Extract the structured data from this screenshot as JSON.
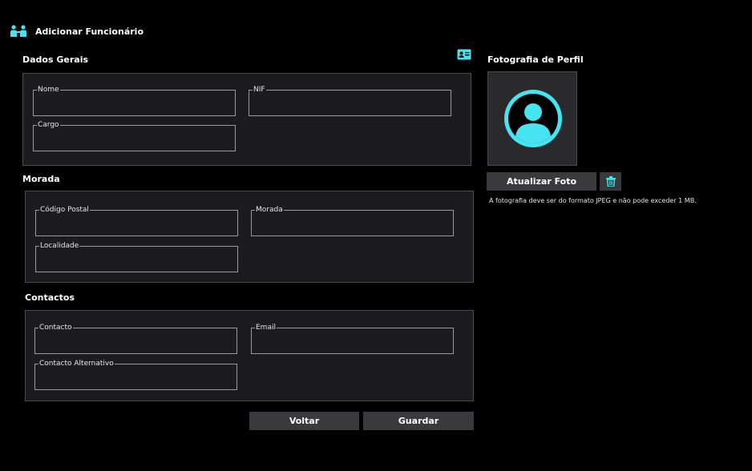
{
  "page": {
    "title": "Adicionar Funcionário",
    "header_icon": "people-group-icon",
    "accent_color": "#46e3f1"
  },
  "general": {
    "title": "Dados Gerais",
    "card_icon": "id-card-icon",
    "name_label": "Nome",
    "name_value": "",
    "nif_label": "NIF",
    "nif_value": "",
    "role_label": "Cargo",
    "role_value": ""
  },
  "address": {
    "title": "Morada",
    "postal_label": "Código Postal",
    "postal_value": "",
    "street_label": "Morada",
    "street_value": "",
    "locality_label": "Localidade",
    "locality_value": ""
  },
  "contacts": {
    "title": "Contactos",
    "contact_label": "Contacto",
    "contact_value": "",
    "email_label": "Email",
    "email_value": "",
    "alt_label": "Contacto Alternativo",
    "alt_value": ""
  },
  "actions": {
    "back_label": "Voltar",
    "save_label": "Guardar"
  },
  "photo": {
    "title": "Fotografia de Perfil",
    "update_label": "Atualizar Foto",
    "delete_icon": "trash-icon",
    "avatar_icon": "user-avatar-icon",
    "note": "A fotografia deve ser do formato JPEG e não pode exceder 1 MB."
  }
}
